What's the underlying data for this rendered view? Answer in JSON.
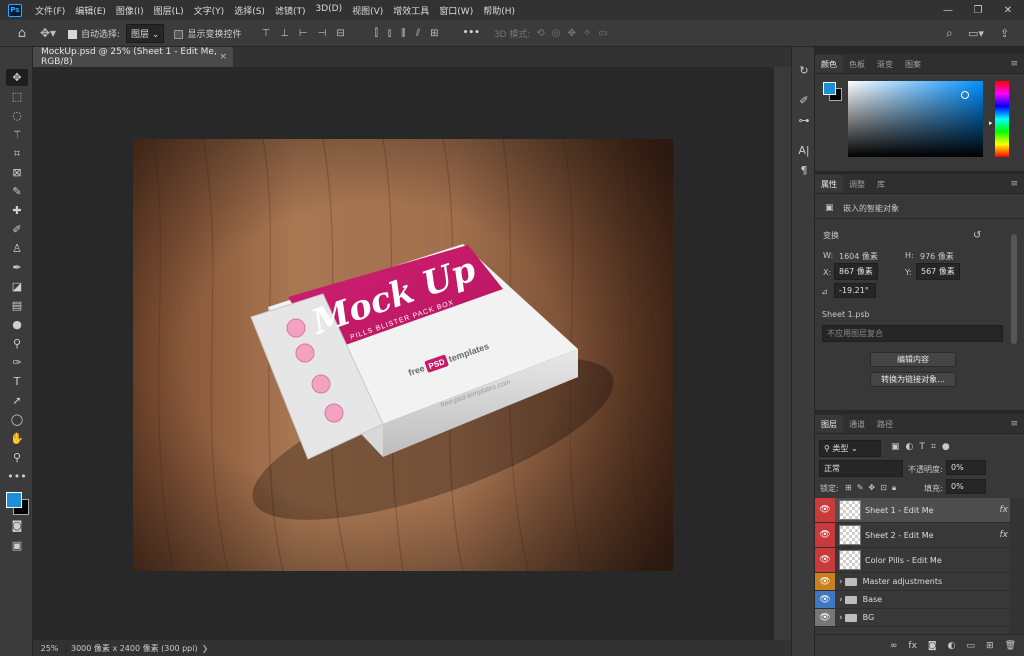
{
  "app": {
    "logo": "Ps"
  },
  "menu": [
    "文件(F)",
    "编辑(E)",
    "图像(I)",
    "图层(L)",
    "文字(Y)",
    "选择(S)",
    "滤镜(T)",
    "3D(D)",
    "视图(V)",
    "增效工具",
    "窗口(W)",
    "帮助(H)"
  ],
  "window_controls": {
    "minimize": "—",
    "maximize": "❐",
    "close": "✕"
  },
  "options": {
    "auto_select_label": "自动选择:",
    "auto_select_value": "图层",
    "transform_label": "显示变换控件",
    "mode3d": "3D 模式:",
    "more": "•••"
  },
  "document": {
    "tab_title": "MockUp.psd @ 25% (Sheet 1 - Edit Me, RGB/8)",
    "tab_close": "×",
    "zoom": "25%",
    "info": "3000 像素 x 2400 像素 (300 ppi)",
    "status_arrow": "❯"
  },
  "mockup": {
    "title": "Mock Up",
    "subtitle": "PILLS BLISTER PACK BOX",
    "brand_free": "free",
    "brand_psd": "PSD",
    "brand_templates": "templates",
    "url": "free-psd-templates.com"
  },
  "color_panel": {
    "tabs": [
      "颜色",
      "色板",
      "渐变",
      "图案"
    ],
    "fg": "#1e8fd6",
    "bg": "#000000"
  },
  "properties": {
    "tabs": [
      "属性",
      "调整",
      "库"
    ],
    "type": "嵌入的智能对象",
    "transform": "变换",
    "w_label": "W:",
    "w": "1604 像素",
    "h_label": "H:",
    "h": "976 像素",
    "x_label": "X:",
    "x": "867 像素",
    "y_label": "Y:",
    "y": "567 像素",
    "angle": "-19.21°",
    "file": "Sheet 1.psb",
    "comp": "不应用图层复合",
    "edit_btn": "编辑内容",
    "convert_btn": "转换为链接对象..."
  },
  "layers_panel": {
    "tabs": [
      "图层",
      "通道",
      "路径"
    ],
    "filter": "类型",
    "blend": "正常",
    "opacity_label": "不透明度:",
    "opacity": "0%",
    "lock_label": "锁定:",
    "fill_label": "填充:",
    "fill": "0%",
    "fx": "fx",
    "layers": [
      {
        "name": "Sheet 1 - Edit Me",
        "eye": "#c93a3a",
        "kind": "smart",
        "fx": true,
        "selected": true
      },
      {
        "name": "Sheet 2 - Edit Me",
        "eye": "#c93a3a",
        "kind": "smart",
        "fx": true
      },
      {
        "name": "Color Pills - Edit Me",
        "eye": "#c93a3a",
        "kind": "smart",
        "fx": false
      },
      {
        "name": "Master adjustments",
        "eye": "#c8811c",
        "kind": "group"
      },
      {
        "name": "Base",
        "eye": "#3f77c0",
        "kind": "group"
      },
      {
        "name": "BG",
        "eye": "#777777",
        "kind": "group"
      }
    ]
  }
}
